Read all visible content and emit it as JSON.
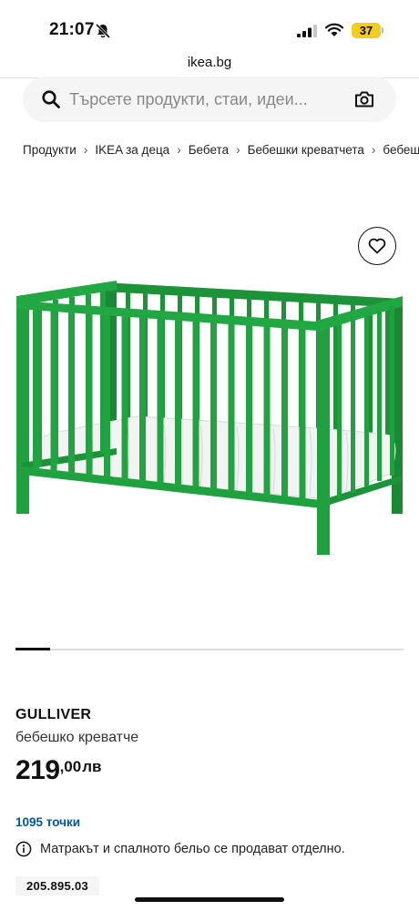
{
  "status_bar": {
    "time": "21:07",
    "battery": "37"
  },
  "browser": {
    "url": "ikea.bg"
  },
  "search": {
    "placeholder": "Търсете продукти, стаи, идеи..."
  },
  "breadcrumb": [
    "Продукти",
    "IKEA за деца",
    "Бебета",
    "Бебешки креватчета",
    "бебешко креватче"
  ],
  "product": {
    "name": "GULLIVER",
    "description": "бебешко креватче",
    "price_integer": "219",
    "price_cents": ",00",
    "currency": "лв",
    "points": "1095 точки",
    "note": "Матракът и спалното бельо се продават отделно.",
    "article_number": "205.895.03",
    "color": "#1f9a3c"
  },
  "carousel": {
    "current": 1
  },
  "icons": [
    "bell-slash-icon",
    "signal-icon",
    "wifi-icon",
    "search-icon",
    "camera-icon",
    "heart-icon",
    "info-icon",
    "chevron-right-icon"
  ]
}
